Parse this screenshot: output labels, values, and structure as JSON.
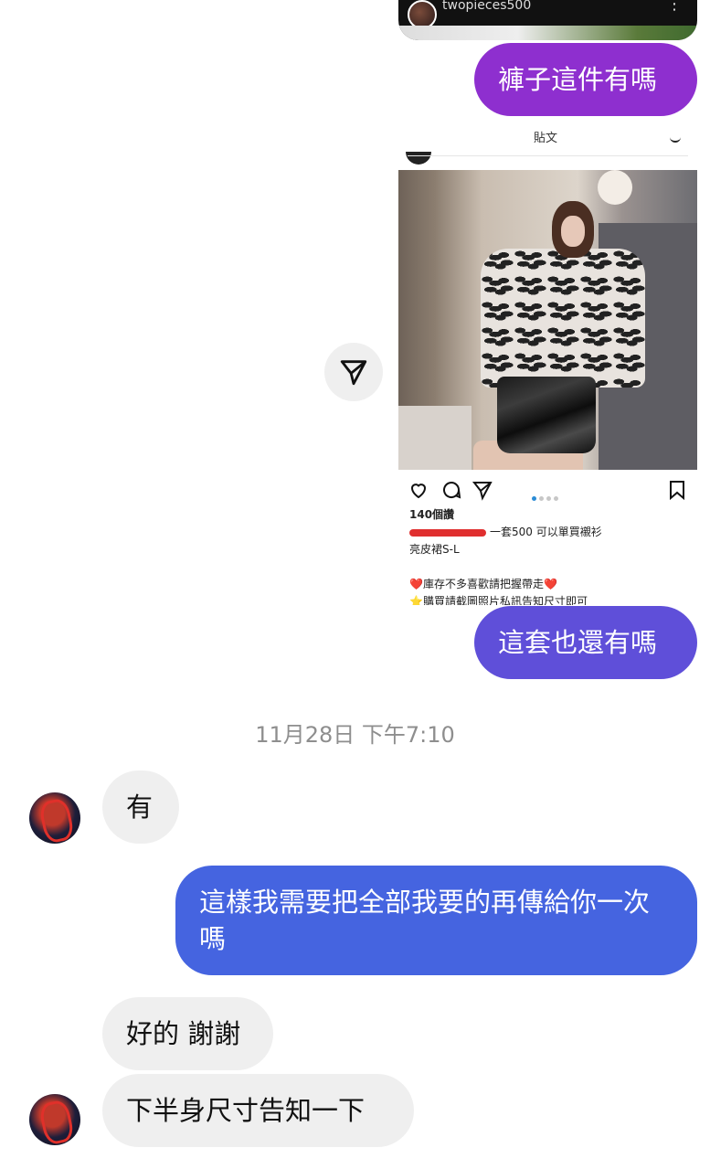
{
  "shared_post_top": {
    "username": "twopieces500"
  },
  "messages": {
    "b1": "褲子這件有嗎",
    "b2": "這套也還有嗎",
    "timestamp": "11月28日 下午7:10",
    "b4": "有",
    "b3": "這樣我需要把全部我要的再傳給你一次嗎",
    "b5": "好的 謝謝",
    "b6": "下半身尺寸告知一下"
  },
  "shared_post": {
    "header_title": "貼文",
    "likes": "140個讚",
    "caption_line1": "一套500 可以單買襯衫",
    "caption_line2": "亮皮裙S-L",
    "caption_line3": "❤️庫存不多喜歡請把握帶走❤️",
    "caption_line4": "⭐購買請截圖照片私訊告知尺寸即可",
    "caption_cut": "…"
  },
  "colors": {
    "bubble1": "#8e2fcf",
    "bubble2": "#5f4fd9",
    "bubble3": "#4564e0",
    "incoming": "#efefef",
    "timestamp": "#8e8e8e"
  }
}
